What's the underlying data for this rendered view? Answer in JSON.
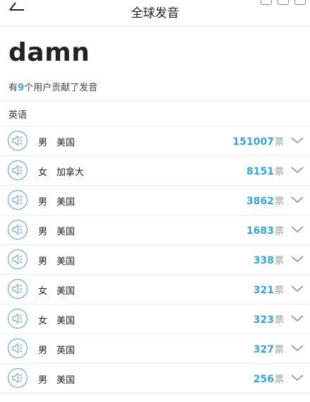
{
  "header": {
    "title": "全球发音"
  },
  "word": "damn",
  "contributors": {
    "prefix": "有",
    "count": "9",
    "suffix": "个用户贡献了发音"
  },
  "section_label": "英语",
  "vote_unit": "票",
  "accent_color": "#3aa3d6",
  "rows": [
    {
      "gender": "男",
      "country": "美国",
      "votes": "151007"
    },
    {
      "gender": "女",
      "country": "加拿大",
      "votes": "8151"
    },
    {
      "gender": "男",
      "country": "美国",
      "votes": "3862"
    },
    {
      "gender": "男",
      "country": "美国",
      "votes": "1683"
    },
    {
      "gender": "男",
      "country": "美国",
      "votes": "338"
    },
    {
      "gender": "女",
      "country": "美国",
      "votes": "321"
    },
    {
      "gender": "女",
      "country": "美国",
      "votes": "323"
    },
    {
      "gender": "男",
      "country": "英国",
      "votes": "327"
    },
    {
      "gender": "男",
      "country": "美国",
      "votes": "256"
    }
  ]
}
